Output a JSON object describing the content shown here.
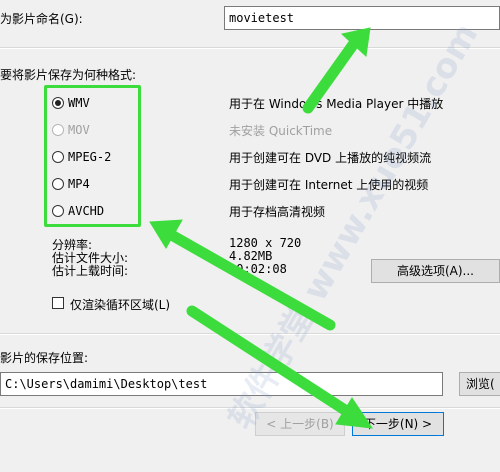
{
  "name_field": {
    "label": "为影片命名(G):",
    "value": "movietest"
  },
  "format_section": {
    "label": "要将影片保存为何种格式:",
    "formats": [
      {
        "label": "WMV",
        "description": "用于在 Windows Media Player 中播放",
        "checked": true,
        "disabled": false
      },
      {
        "label": "MOV",
        "description": "未安装 QuickTime",
        "checked": false,
        "disabled": true
      },
      {
        "label": "MPEG-2",
        "description": "用于创建可在 DVD 上播放的纯视频流",
        "checked": false,
        "disabled": false
      },
      {
        "label": "MP4",
        "description": "用于创建可在 Internet 上使用的视频",
        "checked": false,
        "disabled": false
      },
      {
        "label": "AVCHD",
        "description": "用于存档高清视频",
        "checked": false,
        "disabled": false
      }
    ]
  },
  "info": {
    "resolution_label": "分辨率:",
    "resolution_value": "1280 x 720",
    "filesize_label": "估计文件大小:",
    "filesize_value": "4.82MB",
    "upload_label": "估计上载时间:",
    "upload_value": "00:02:08"
  },
  "advanced_button": "高级选项(A)...",
  "loop_checkbox": {
    "label": "仅渲染循环区域(L)",
    "checked": false
  },
  "save_location": {
    "label": "影片的保存位置:",
    "value": "C:\\Users\\damimi\\Desktop\\test",
    "browse_label": "浏览("
  },
  "footer": {
    "back_label": "< 上一步(B)",
    "next_label": "下一步(N) >"
  },
  "watermark": "软件学堂 www.xue51.com",
  "colors": {
    "annotation": "#3ddc3d",
    "dialog_bg": "#f0f0f0"
  }
}
